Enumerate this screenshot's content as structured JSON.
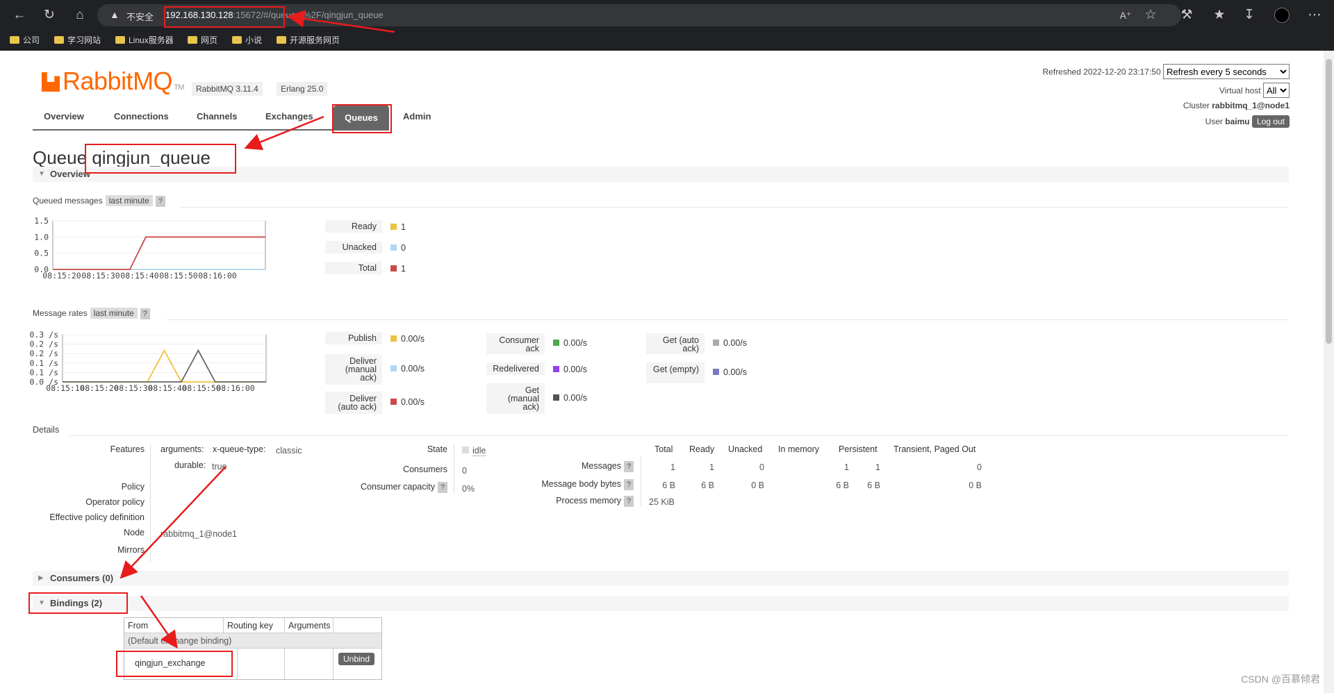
{
  "browser": {
    "insecure_label": "不安全",
    "url_host": "192.168.130.128",
    "url_rest": ":15672/#/queues/%2F/qingjun_queue",
    "bookmarks": [
      "公司",
      "学习网站",
      "Linux服务器",
      "网页",
      "小说",
      "开源服务网页"
    ],
    "icons": [
      "back-icon",
      "reload-icon",
      "home-icon",
      "read-aloud-icon",
      "favorite-icon",
      "extensions-icon",
      "favorites-bar-icon",
      "downloads-icon",
      "profile-icon",
      "more-icon"
    ]
  },
  "app": {
    "logo": "RabbitMQ",
    "logo_tm": "TM",
    "version": "RabbitMQ 3.11.4",
    "erlang": "Erlang 25.0",
    "nav": [
      "Overview",
      "Connections",
      "Channels",
      "Exchanges",
      "Queues",
      "Admin"
    ],
    "active_tab": "Queues",
    "refreshed": "Refreshed 2022-12-20 23:17:50",
    "refresh_select": "Refresh every 5 seconds",
    "vhost_label": "Virtual host",
    "vhost_select": "All",
    "cluster_label": "Cluster",
    "cluster": "rabbitmq_1@node1",
    "user_label": "User",
    "user": "baimu",
    "logout": "Log out"
  },
  "page": {
    "title_prefix": "Queue",
    "queue_name": "qingjun_queue",
    "overview_section": "Overview",
    "queued_messages_label": "Queued messages",
    "message_rates_label": "Message rates",
    "last_minute": "last minute",
    "help": "?"
  },
  "chart_data": [
    {
      "type": "line",
      "title": "Queued messages",
      "x": [
        "08:15:20",
        "08:15:30",
        "08:15:40",
        "08:15:50",
        "08:16:00"
      ],
      "y_ticks": [
        "1.5",
        "1.0",
        "0.5",
        "0.0"
      ],
      "ylim": [
        0,
        1.5
      ],
      "series": [
        {
          "name": "Ready",
          "color": "#edc240",
          "points": [
            [
              0,
              0
            ],
            [
              29,
              0
            ],
            [
              41,
              0
            ],
            [
              80,
              0
            ]
          ]
        },
        {
          "name": "Unacked",
          "color": "#afd8f8",
          "points": [
            [
              0,
              0
            ],
            [
              80,
              0
            ]
          ]
        },
        {
          "name": "Total",
          "color": "#cb4b4b",
          "points": [
            [
              0,
              0
            ],
            [
              29,
              0
            ],
            [
              35,
              1
            ],
            [
              80,
              1
            ]
          ]
        }
      ],
      "legend": [
        {
          "label": "Ready",
          "value": "1",
          "color": "#edc240"
        },
        {
          "label": "Unacked",
          "value": "0",
          "color": "#afd8f8"
        },
        {
          "label": "Total",
          "value": "1",
          "color": "#cb4b4b"
        }
      ]
    },
    {
      "type": "line",
      "title": "Message rates",
      "x": [
        "08:15:10",
        "08:15:20",
        "08:15:30",
        "08:15:40",
        "08:15:50",
        "08:16:00"
      ],
      "y_ticks": [
        "0.3 /s",
        "0.2 /s",
        "0.2 /s",
        "0.1 /s",
        "0.1 /s",
        "0.0 /s"
      ],
      "ylim": [
        0,
        0.3
      ],
      "series": [
        {
          "name": "Publish",
          "color": "#edc240",
          "points": [
            [
              0,
              0
            ],
            [
              25,
              0
            ],
            [
              30,
              0.2
            ],
            [
              35,
              0
            ],
            [
              60,
              0
            ]
          ]
        },
        {
          "name": "Deliver (manual ack)",
          "color": "#666666",
          "points": [
            [
              0,
              0
            ],
            [
              35,
              0
            ],
            [
              40,
              0.2
            ],
            [
              45,
              0
            ],
            [
              60,
              0
            ]
          ]
        }
      ],
      "legend": [
        {
          "label": "Publish",
          "value": "0.00/s",
          "color": "#edc240"
        },
        {
          "label": "Deliver (manual ack)",
          "value": "0.00/s",
          "color": "#afd8f8"
        },
        {
          "label": "Deliver (auto ack)",
          "value": "0.00/s",
          "color": "#cb4b4b"
        },
        {
          "label": "Consumer ack",
          "value": "0.00/s",
          "color": "#4da74d"
        },
        {
          "label": "Redelivered",
          "value": "0.00/s",
          "color": "#9440ed"
        },
        {
          "label": "Get (manual ack)",
          "value": "0.00/s",
          "color": "#555555"
        },
        {
          "label": "Get (auto ack)",
          "value": "0.00/s",
          "color": "#aaaaaa"
        },
        {
          "label": "Get (empty)",
          "value": "0.00/s",
          "color": "#7c79c2"
        }
      ]
    }
  ],
  "details": {
    "heading": "Details",
    "features_label": "Features",
    "arguments_key": "arguments:",
    "arguments_val": "x-queue-type:",
    "arguments_type": "classic",
    "durable_key": "durable:",
    "durable_val": "true",
    "policy_label": "Policy",
    "operator_policy_label": "Operator policy",
    "effective_policy_label": "Effective policy definition",
    "node_label": "Node",
    "node_val": "rabbitmq_1@node1",
    "mirrors_label": "Mirrors",
    "state_label": "State",
    "state_val": "idle",
    "consumers_label": "Consumers",
    "consumers_val": "0",
    "capacity_label": "Consumer capacity",
    "capacity_val": "0%",
    "stats_headers": [
      "Total",
      "Ready",
      "Unacked",
      "In memory",
      "Persistent",
      "Transient, Paged Out"
    ],
    "stats_rows": [
      {
        "label": "Messages",
        "values": [
          "1",
          "1",
          "0",
          "1",
          "1",
          "0"
        ]
      },
      {
        "label": "Message body bytes",
        "values": [
          "6 B",
          "6 B",
          "0 B",
          "6 B",
          "6 B",
          "0 B"
        ]
      },
      {
        "label": "Process memory",
        "values": [
          "25 KiB"
        ]
      }
    ]
  },
  "consumers_section": "Consumers (0)",
  "bindings": {
    "section": "Bindings (2)",
    "headers": [
      "From",
      "Routing key",
      "Arguments"
    ],
    "default_row": "(Default exchange binding)",
    "rows": [
      {
        "from": "qingjun_exchange",
        "routing_key": "",
        "arguments": "",
        "action": "Unbind"
      }
    ]
  },
  "watermark": "CSDN @百慕倾君"
}
